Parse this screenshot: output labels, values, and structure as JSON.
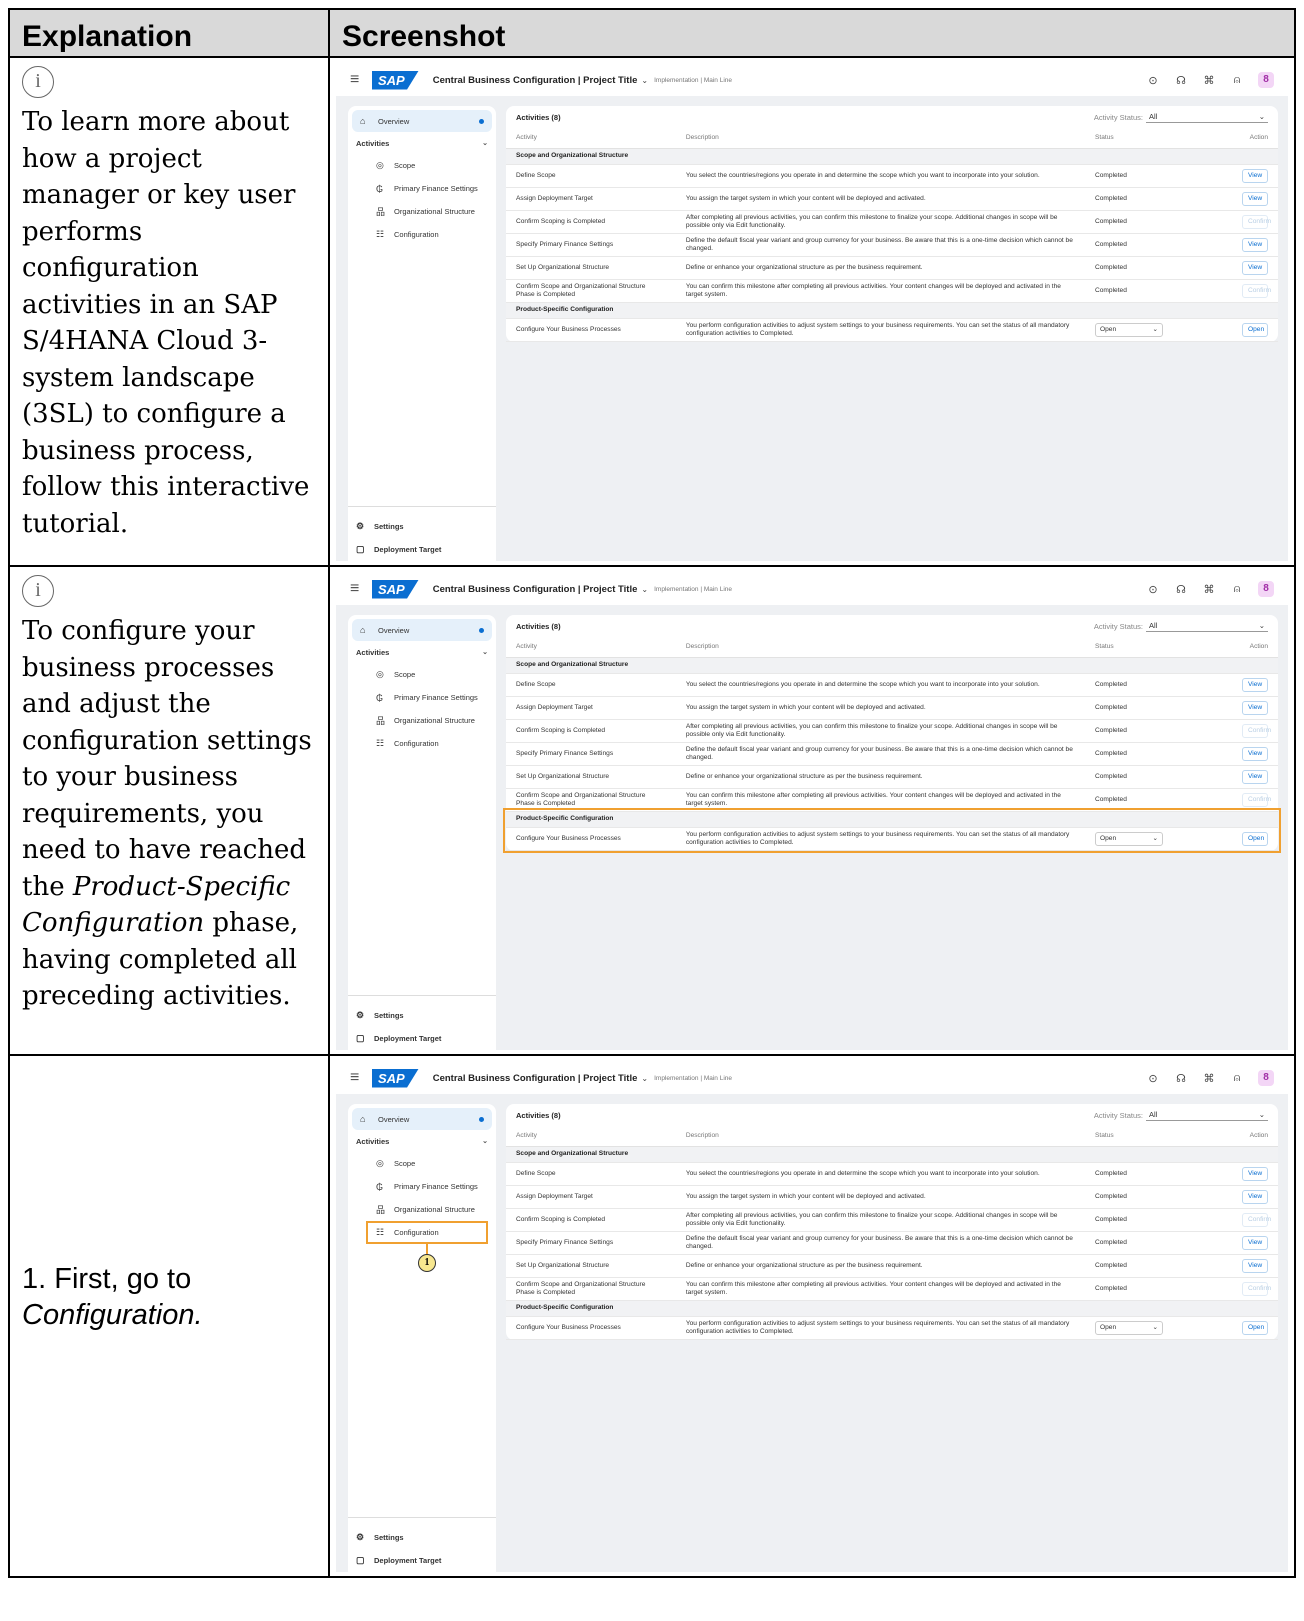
{
  "header": {
    "col1": "Explanation",
    "col2": "Screenshot"
  },
  "rows": [
    {
      "icon": "i",
      "text": "To learn more about how a project manager or key user performs configuration activities in an SAP S/4HANA Cloud 3-system landscape (3SL) to configure a business process, follow this interactive tutorial."
    },
    {
      "icon": "i",
      "text_before": "To configure your business processes and adjust the configuration settings to your business requirements, you need to have reached the ",
      "text_em": "Product-Specific Configuration",
      "text_after": " phase, having completed all preceding activities."
    },
    {
      "text_before": "1. First, go to ",
      "text_em": "Configuration."
    }
  ],
  "sap": {
    "logo": "SAP",
    "title": "Central Business Configuration | Project Title",
    "crumb": "Implementation | Main Line",
    "avatar": "8",
    "sidebar": {
      "overview": "Overview",
      "activities": "Activities",
      "items": [
        "Scope",
        "Primary Finance Settings",
        "Organizational Structure",
        "Configuration"
      ],
      "settings": "Settings",
      "deployment": "Deployment Target"
    },
    "toolbar": {
      "title": "Activities (8)",
      "filter_label": "Activity Status:",
      "filter_value": "All"
    },
    "columns": [
      "Activity",
      "Description",
      "Status",
      "Action"
    ],
    "groups": [
      {
        "name": "Scope and Organizational Structure",
        "rows": [
          {
            "activity": "Define Scope",
            "desc": "You select the countries/regions you operate in and determine the scope which you want to incorporate into your solution.",
            "status": "Completed",
            "action": "View",
            "disabled": false
          },
          {
            "activity": "Assign Deployment Target",
            "desc": "You assign the target system in which your content will be deployed and activated.",
            "status": "Completed",
            "action": "View",
            "disabled": false
          },
          {
            "activity": "Confirm Scoping is Completed",
            "desc": "After completing all previous activities, you can confirm this milestone to finalize your scope. Additional changes in scope will be possible only via Edit functionality.",
            "status": "Completed",
            "action": "Confirm",
            "disabled": true
          },
          {
            "activity": "Specify Primary Finance Settings",
            "desc": "Define the default fiscal year variant and group currency for your business. Be aware that this is a one-time decision which cannot be changed.",
            "status": "Completed",
            "action": "View",
            "disabled": false
          },
          {
            "activity": "Set Up Organizational Structure",
            "desc": "Define or enhance your organizational structure as per the business requirement.",
            "status": "Completed",
            "action": "View",
            "disabled": false
          },
          {
            "activity": "Confirm Scope and Organizational Structure Phase is Completed",
            "desc": "You can confirm this milestone after completing all previous activities. Your content changes will be deployed and activated in the target system.",
            "status": "Completed",
            "action": "Confirm",
            "disabled": true
          }
        ]
      },
      {
        "name": "Product-Specific Configuration",
        "rows": [
          {
            "activity": "Configure Your Business Processes",
            "desc": "You perform configuration activities to adjust system settings to your business requirements. You can set the status of all mandatory configuration activities to Completed.",
            "status": "Open",
            "action": "Open",
            "disabled": false,
            "dropdown": true
          }
        ]
      }
    ]
  },
  "marker": "1"
}
